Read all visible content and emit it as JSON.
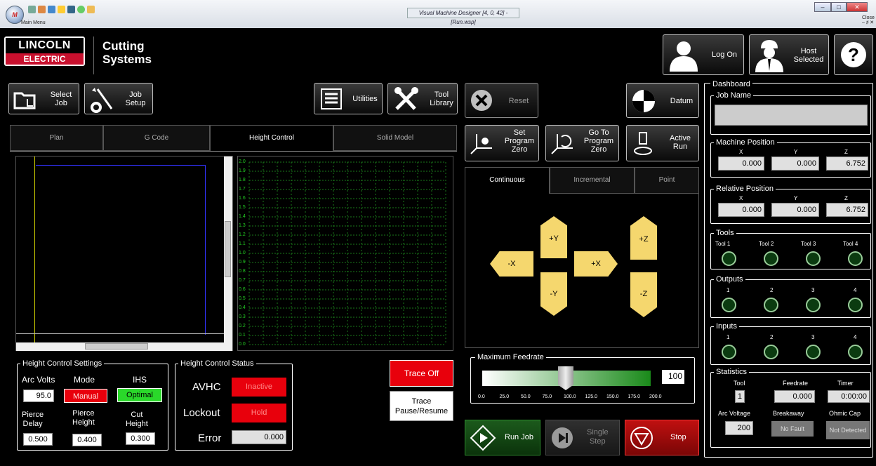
{
  "titlebar": {
    "doc_title": "Visual Machine Designer [4, 0, 42] - [Run.wsp]",
    "main_menu": "Main Menu",
    "close": "Close"
  },
  "logo": {
    "line1": "LINCOLN",
    "line2": "ELECTRIC"
  },
  "system": {
    "line1": "Cutting",
    "line2": "Systems"
  },
  "header": {
    "logon": "Log On",
    "host_line1": "Host",
    "host_line2": "Selected",
    "help": "?"
  },
  "toolbar": {
    "select_job": [
      "Select",
      "Job"
    ],
    "job_setup": [
      "Job",
      "Setup"
    ],
    "utilities": "Utilities",
    "tool_library": [
      "Tool",
      "Library"
    ],
    "reset": "Reset",
    "datum": "Datum"
  },
  "tabs": [
    "Plan",
    "G Code",
    "Height Control",
    "Solid Model"
  ],
  "graph": {
    "ticks": [
      "2.0",
      "1.9",
      "1.8",
      "1.7",
      "1.6",
      "1.5",
      "1.4",
      "1.3",
      "1.2",
      "1.1",
      "1.0",
      "0.9",
      "0.8",
      "0.7",
      "0.6",
      "0.5",
      "0.4",
      "0.3",
      "0.2",
      "0.1",
      "0.0"
    ]
  },
  "program": {
    "set_zero": [
      "Set",
      "Program",
      "Zero"
    ],
    "goto_zero": [
      "Go To",
      "Program",
      "Zero"
    ],
    "active_run": [
      "Active",
      "Run"
    ]
  },
  "jog_tabs": [
    "Continuous",
    "Incremental",
    "Point"
  ],
  "jog": {
    "py": "+Y",
    "my": "-Y",
    "mx": "-X",
    "px": "+X",
    "pz": "+Z",
    "mz": "-Z"
  },
  "feedrate": {
    "title": "Maximum Feedrate",
    "value": "100",
    "ticks": [
      "0.0",
      "25.0",
      "50.0",
      "75.0",
      "100.0",
      "125.0",
      "150.0",
      "175.0",
      "200.0"
    ],
    "level_percent": 100
  },
  "hc_settings": {
    "title": "Height Control Settings",
    "arc_volts_label": "Arc Volts",
    "mode_label": "Mode",
    "ihs_label": "IHS",
    "arc_volts": "95.0",
    "mode": "Manual",
    "ihs": "Optimal",
    "pierce_delay_label": [
      "Pierce",
      "Delay"
    ],
    "pierce_height_label": [
      "Pierce",
      "Height"
    ],
    "cut_height_label": [
      "Cut",
      "Height"
    ],
    "pierce_delay": "0.500",
    "pierce_height": "0.400",
    "cut_height": "0.300"
  },
  "hc_status": {
    "title": "Height Control Status",
    "avhc_label": "AVHC",
    "avhc": "Inactive",
    "lockout_label": "Lockout",
    "lockout": "Hold",
    "error_label": "Error",
    "error": "0.000"
  },
  "trace": {
    "off": "Trace Off",
    "pause_line1": "Trace",
    "pause_line2": "Pause/Resume"
  },
  "run": {
    "run_job": "Run Job",
    "single_step": [
      "Single",
      "Step"
    ],
    "stop": "Stop"
  },
  "dashboard": {
    "title": "Dashboard",
    "job_name_label": "Job Name",
    "job_name": "",
    "machine_pos": {
      "title": "Machine Position",
      "axes": [
        "X",
        "Y",
        "Z"
      ],
      "values": [
        "0.000",
        "0.000",
        "6.752"
      ]
    },
    "relative_pos": {
      "title": "Relative Position",
      "axes": [
        "X",
        "Y",
        "Z"
      ],
      "values": [
        "0.000",
        "0.000",
        "6.752"
      ]
    },
    "tools": {
      "title": "Tools",
      "labels": [
        "Tool 1",
        "Tool 2",
        "Tool 3",
        "Tool 4"
      ]
    },
    "outputs": {
      "title": "Outputs",
      "labels": [
        "1",
        "2",
        "3",
        "4"
      ]
    },
    "inputs": {
      "title": "Inputs",
      "labels": [
        "1",
        "2",
        "3",
        "4"
      ]
    },
    "stats": {
      "title": "Statistics",
      "tool_label": "Tool",
      "feedrate_label": "Feedrate",
      "timer_label": "Timer",
      "tool": "1",
      "feedrate": "0.000",
      "timer": "0:00:00",
      "arc_voltage_label": "Arc Voltage",
      "breakaway_label": "Breakaway",
      "ohmic_label": "Ohmic Cap",
      "arc_voltage": "200",
      "breakaway": "No Fault",
      "ohmic": "Not Detected"
    }
  },
  "colors": {
    "accent_red": "#e8000c",
    "accent_green": "#00c800",
    "jog_yellow": "#f5d76e"
  }
}
